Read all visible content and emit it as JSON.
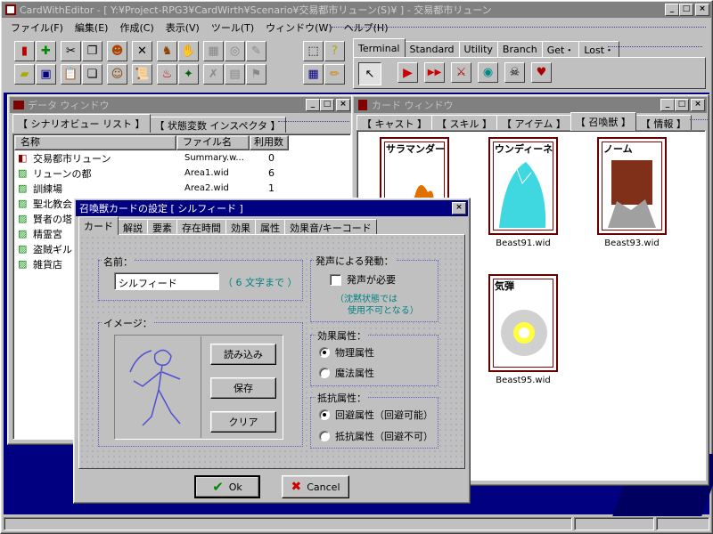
{
  "app": {
    "title": "CardWithEditor - [ Y:¥Project-RPG3¥CardWirth¥Scenario¥交易都市リューン(S)¥ ] - 交易都市リューン"
  },
  "menu": [
    "ファイル(F)",
    "編集(E)",
    "作成(C)",
    "表示(V)",
    "ツール(T)",
    "ウィンドウ(W)",
    "ヘルプ(H)"
  ],
  "toolbar_tabs": [
    "Terminal",
    "Standard",
    "Utility",
    "Branch",
    "Get・",
    "Lost・"
  ],
  "data_window": {
    "title": "データ ウィンドウ",
    "tabs": [
      "【 シナリオビュー リスト 】",
      "【 状態変数 インスペクタ 】"
    ],
    "columns": [
      "名称",
      "ファイル名",
      "利用数"
    ],
    "rows": [
      {
        "name": "交易都市リューン",
        "file": "Summary.w...",
        "count": "0"
      },
      {
        "name": "リューンの都",
        "file": "Area1.wid",
        "count": "6"
      },
      {
        "name": "訓練場",
        "file": "Area2.wid",
        "count": "1"
      },
      {
        "name": "聖北教会",
        "file": "",
        "count": ""
      },
      {
        "name": "賢者の塔",
        "file": "",
        "count": ""
      },
      {
        "name": "精霊宮",
        "file": "",
        "count": ""
      },
      {
        "name": "盗賊ギルド",
        "file": "",
        "count": ""
      },
      {
        "name": "雑貨店",
        "file": "",
        "count": ""
      }
    ]
  },
  "card_window": {
    "title": "カード ウィンドウ",
    "tabs": [
      "【 キャスト 】",
      "【 スキル 】",
      "【 アイテム 】",
      "【 召喚獣 】",
      "【 情報 】"
    ],
    "cards": [
      {
        "name": "サラマンダー",
        "file": ""
      },
      {
        "name": "ウンディーネ",
        "file": "Beast91.wid"
      },
      {
        "name": "ノーム",
        "file": "Beast93.wid"
      },
      {
        "name": "気弾",
        "file": "Beast95.wid"
      }
    ]
  },
  "dialog": {
    "title": "召喚獣カードの設定 [ シルフィード ]",
    "tabs": [
      "カード",
      "解説",
      "要素",
      "存在時間",
      "効果",
      "属性",
      "効果音/キーコード"
    ],
    "name_label": "名前：",
    "name_value": "シルフィード",
    "name_hint": "（ 6 文字まで ）",
    "image_label": "イメージ：",
    "btn_load": "読み込み",
    "btn_save": "保存",
    "btn_clear": "クリア",
    "voice_label": "発声による発動：",
    "voice_check": "発声が必要",
    "voice_note1": "（沈黙状態では",
    "voice_note2": "使用不可となる）",
    "effect_label": "効果属性：",
    "effect_opts": [
      "物理属性",
      "魔法属性"
    ],
    "resist_label": "抵抗属性：",
    "resist_opts": [
      "回避属性（回避可能）",
      "抵抗属性（回避不可）"
    ],
    "ok": "Ok",
    "cancel": "Cancel"
  },
  "colors": {
    "desktop": "#000080",
    "title_active": "#000080",
    "title_inactive": "#808080",
    "face": "#c0c0c0",
    "accent_text": "#008080"
  }
}
